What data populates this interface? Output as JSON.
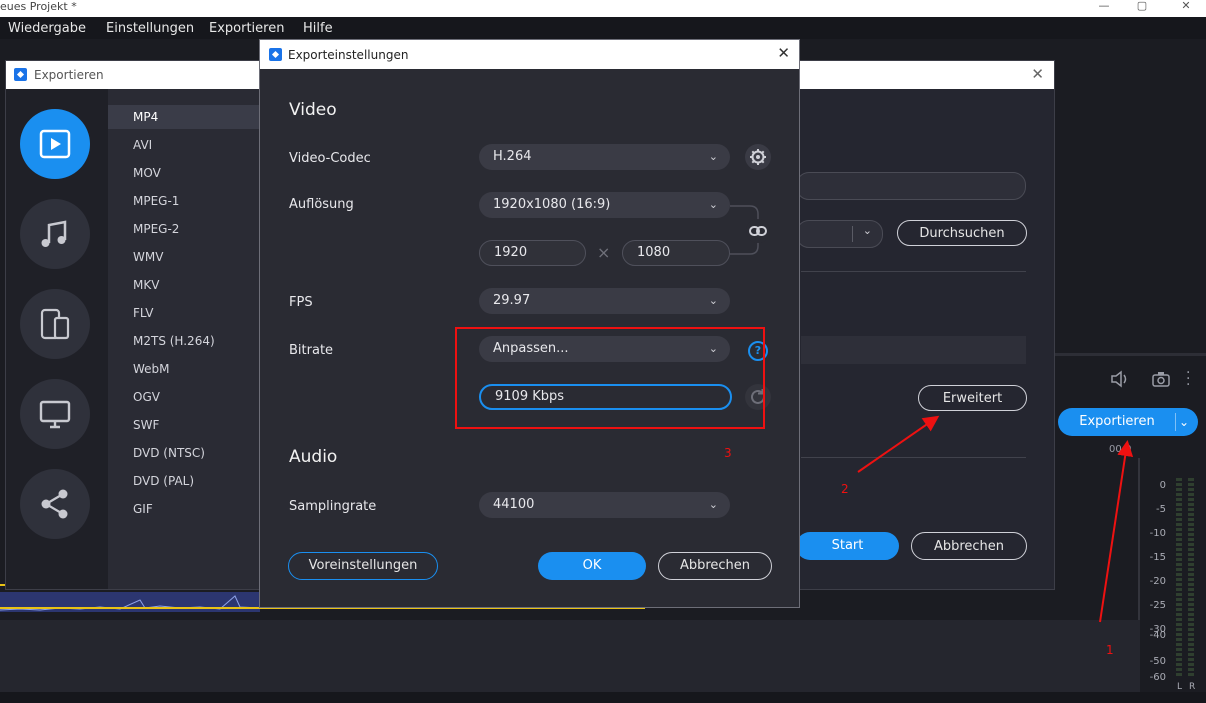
{
  "app": {
    "title": "eues Projekt *",
    "window_controls": [
      "—",
      "▢",
      "✕"
    ],
    "menu": [
      "Wiedergabe",
      "Einstellungen",
      "Exportieren",
      "Hilfe"
    ]
  },
  "export_window": {
    "title": "Exportieren",
    "close": "✕",
    "sidebar_icons": [
      "video-icon",
      "music-icon",
      "devices-icon",
      "monitor-icon",
      "share-icon"
    ],
    "formats": [
      "MP4",
      "AVI",
      "MOV",
      "MPEG-1",
      "MPEG-2",
      "WMV",
      "MKV",
      "FLV",
      "M2TS (H.264)",
      "WebM",
      "OGV",
      "SWF",
      "DVD (NTSC)",
      "DVD (PAL)",
      "GIF"
    ],
    "selected_format": "MP4",
    "browse_label": "Durchsuchen",
    "advanced_label": "Erweitert",
    "start_label": "Start",
    "cancel_label": "Abbrechen"
  },
  "main_export_button": "Exportieren",
  "timecode": "00:0",
  "meter_labels": [
    "0",
    "-5",
    "-10",
    "-15",
    "-20",
    "-25",
    "-30",
    "-40",
    "-50",
    "-60"
  ],
  "meter_channels": [
    "L",
    "R"
  ],
  "dialog": {
    "title": "Exporteinstellungen",
    "close": "✕",
    "video_heading": "Video",
    "codec_label": "Video-Codec",
    "codec_value": "H.264",
    "resolution_label": "Auflösung",
    "resolution_value": "1920x1080 (16:9)",
    "width_value": "1920",
    "height_value": "1080",
    "times": "×",
    "fps_label": "FPS",
    "fps_value": "29.97",
    "bitrate_label": "Bitrate",
    "bitrate_mode": "Anpassen...",
    "bitrate_value": "9109 Kbps",
    "help": "?",
    "audio_heading": "Audio",
    "sampling_label": "Samplingrate",
    "sampling_value": "44100",
    "presets_label": "Voreinstellungen",
    "ok_label": "OK",
    "cancel_label": "Abbrechen",
    "chevron": "⌄"
  },
  "annotations": [
    "1",
    "2",
    "3"
  ]
}
